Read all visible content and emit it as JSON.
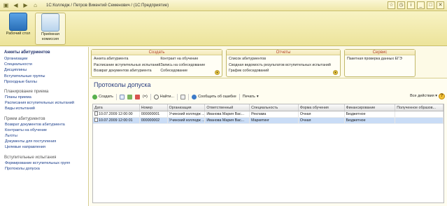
{
  "window": {
    "title": "1С:Колледж / Петров Викентий Семенович / (1С:Предприятие)"
  },
  "ribbon": {
    "items": [
      {
        "label": "Рабочий стол",
        "icon": "desktop-icon"
      },
      {
        "label": "Приёмная комиссия",
        "icon": "admission-icon"
      }
    ]
  },
  "sidebar": {
    "title": "Анкеты абитуриентов",
    "main_links": [
      "Организации",
      "Специальности",
      "Дисциплины",
      "Вступительные группы",
      "Проходные баллы"
    ],
    "sections": [
      {
        "heading": "Планирование приема",
        "links": [
          "Планы приема",
          "Расписания вступительных испытаний",
          "Виды испытаний"
        ]
      },
      {
        "heading": "Прием абитуриентов",
        "links": [
          "Возврат документов абитуриента",
          "Контракты на обучение",
          "Льготы",
          "Документы для поступления",
          "Целевые направления"
        ]
      },
      {
        "heading": "Вступительные испытания",
        "links": [
          "Формирование вступительных групп",
          "Протоколы допуска"
        ]
      }
    ]
  },
  "menu": {
    "groups": [
      {
        "title": "Создать",
        "col1": [
          "Анкета абитуриента",
          "Расписание вступительных испытаний",
          "Возврат документов абитуриента"
        ],
        "col2": [
          "Контракт на обучение",
          "Запись на собеседование",
          "Собеседование"
        ]
      },
      {
        "title": "Отчеты",
        "col1": [
          "Список абитуриентов",
          "Сводная ведомость результатов вступительных испытаний",
          "График собеседований"
        ],
        "col2": []
      },
      {
        "title": "Сервис",
        "col1": [
          "Пакетная проверка данных ЕГЭ"
        ],
        "col2": []
      }
    ]
  },
  "form": {
    "title": "Протоколы допуска",
    "toolbar": {
      "create": "Создать",
      "find": "Найти...",
      "report_error": "Сообщить об ошибке",
      "print": "Печать",
      "all_actions": "Все действия",
      "help": "?"
    },
    "columns": [
      "Дата",
      "Номер",
      "Организация",
      "Ответственный",
      "Специальность",
      "Форма обучения",
      "Финансирование",
      "Полученное образов..."
    ],
    "rows": [
      [
        "10.07.2009 12:00:00",
        "000000001",
        "Учинский колледж ...",
        "Иванова Мария Вас...",
        "Реклама",
        "Очная",
        "Бюджетное",
        ""
      ],
      [
        "10.07.2009 12:00:01",
        "000000002",
        "Учинский колледж ...",
        "Иванова Мария Вас...",
        "Маркетинг",
        "Очная",
        "Бюджетное",
        ""
      ]
    ],
    "selected_row": 1
  }
}
